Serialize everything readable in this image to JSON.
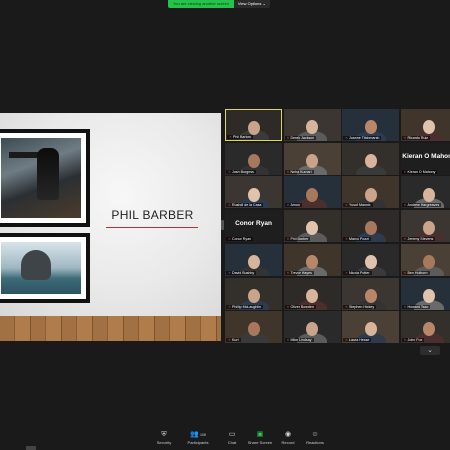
{
  "banner": {
    "message": "You are viewing another screen",
    "options_label": "View Options",
    "options_caret": "⌄"
  },
  "slide": {
    "title": "PHIL BARBER"
  },
  "gallery": {
    "tiles": [
      {
        "name": "Phil Barlow",
        "active": true
      },
      {
        "name": "Derek Jackson"
      },
      {
        "name": "Joanne Titchmarsh"
      },
      {
        "name": "Ricardo Ruiz"
      },
      {
        "name": "Josh Burgess"
      },
      {
        "name": "Neha Kumari"
      },
      {
        "name": ""
      },
      {
        "name": "Kieran O Mahony",
        "big_label": "Kieran O Mahony"
      },
      {
        "name": "Rushdi de la Casa"
      },
      {
        "name": "Amon"
      },
      {
        "name": "Yusuf Mannix"
      },
      {
        "name": "Andrew Hargreaves"
      },
      {
        "name": "Conor Ryan",
        "big_label": "Conor Ryan"
      },
      {
        "name": "Phil Barber"
      },
      {
        "name": "Marco Pozzi"
      },
      {
        "name": "Jeremy Stevens"
      },
      {
        "name": "David Bushby"
      },
      {
        "name": "Trevor Hayes"
      },
      {
        "name": "Nicola Potter"
      },
      {
        "name": "Ben Holborn"
      },
      {
        "name": "Phillip McLaughlin"
      },
      {
        "name": "Oliver Bowden"
      },
      {
        "name": "Stephen Hickey"
      },
      {
        "name": "Howard Tsao"
      },
      {
        "name": "Kurt"
      },
      {
        "name": "Mike Lindsay"
      },
      {
        "name": "Laura Hesse"
      },
      {
        "name": "John Fox"
      }
    ],
    "more_label": "⌄"
  },
  "toolbar": {
    "security": {
      "icon": "shield-icon",
      "label": "Security"
    },
    "participants": {
      "icon": "participants-icon",
      "label": "Participants",
      "count": "108"
    },
    "chat": {
      "icon": "chat-icon",
      "label": "Chat"
    },
    "share": {
      "icon": "share-screen-icon",
      "label": "Share Screen",
      "color": "#2ed158"
    },
    "record": {
      "icon": "record-icon",
      "label": "Record"
    },
    "reactions": {
      "icon": "reactions-icon",
      "label": "Reactions"
    }
  }
}
